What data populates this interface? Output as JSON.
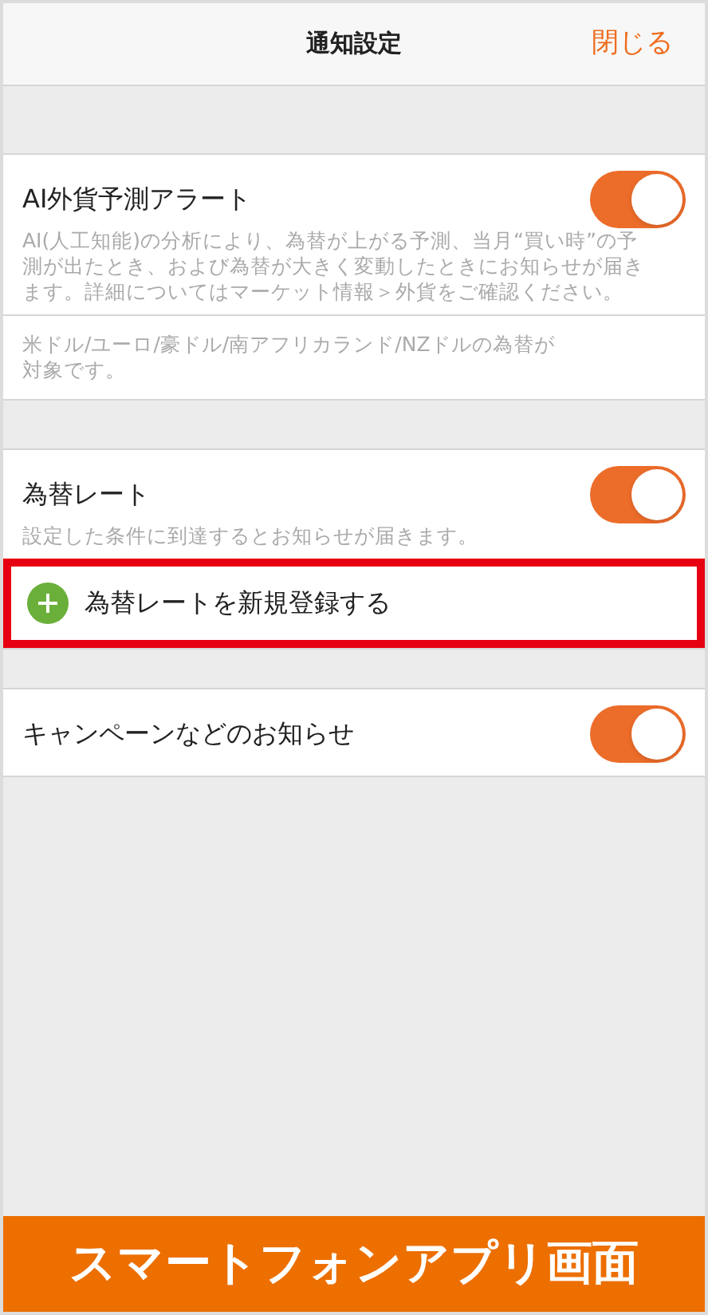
{
  "header": {
    "title": "通知設定",
    "close": "閉じる"
  },
  "sections": [
    {
      "title": "AI外貨予測アラート",
      "on": true,
      "description": "AI(人工知能)の分析により、為替が上がる予測、当月“買い時”の予測が出たとき、および為替が大きく変動したときにお知らせが届きます。詳細についてはマーケット情報＞外貨をご確認ください。",
      "note": "米ドル/ユーロ/豪ドル/南アフリカランド/NZドルの為替が対象です。"
    },
    {
      "title": "為替レート",
      "on": true,
      "description": "設定した条件に到達するとお知らせが届きます。",
      "add_action": {
        "label": "為替レートを新規登録する",
        "highlighted": true
      }
    },
    {
      "title": "キャンペーンなどのお知らせ",
      "on": true
    }
  ],
  "banner": "スマートフォンアプリ画面"
}
